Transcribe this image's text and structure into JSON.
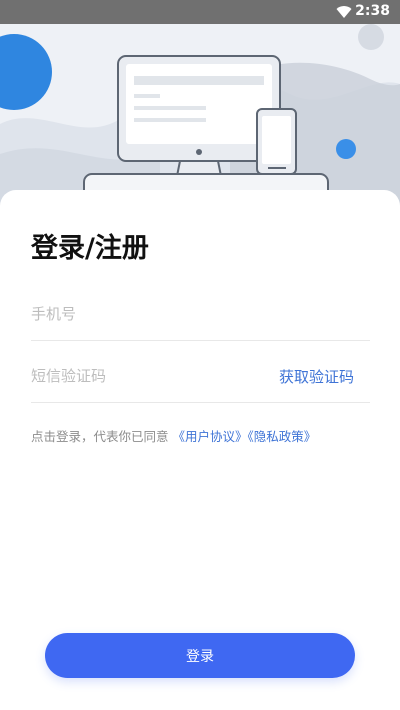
{
  "status_bar": {
    "time": "2:38",
    "icons": [
      "wifi-icon"
    ]
  },
  "hero": {
    "illustration": "desktop-and-phone-illustration"
  },
  "login": {
    "title": "登录/注册",
    "phone_placeholder": "手机号",
    "code_placeholder": "短信验证码",
    "get_code_label": "获取验证码",
    "agreement_prefix": "点击登录，代表你已同意 ",
    "user_agreement": "《用户协议》",
    "privacy_policy": "《隐私政策》",
    "login_button": "登录"
  },
  "colors": {
    "accent": "#3f74d6",
    "button": "#3f68f2",
    "decor_blue": "#3a8fe8"
  }
}
